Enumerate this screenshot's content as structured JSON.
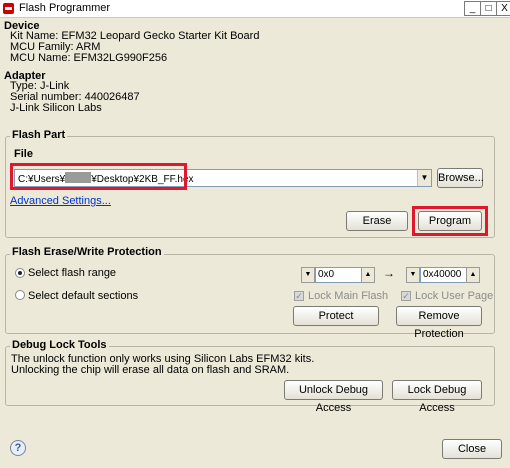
{
  "window": {
    "title": "Flash Programmer",
    "min_symbol": "_",
    "max_symbol": "□",
    "close_symbol": "X"
  },
  "device": {
    "title": "Device",
    "kit_name": "Kit Name: EFM32 Leopard Gecko Starter Kit Board",
    "mcu_family": "MCU Family: ARM",
    "mcu_name": "MCU Name: EFM32LG990F256"
  },
  "adapter": {
    "title": "Adapter",
    "type": "Type: J-Link",
    "serial": "Serial number: 440026487",
    "name": "J-Link Silicon Labs"
  },
  "flash_part": {
    "legend": "Flash Part",
    "file_label": "File",
    "path_prefix": "C:¥Users¥",
    "path_suffix": "¥Desktop¥2KB_FF.hex",
    "browse_label": "Browse...",
    "advanced_link": "Advanced Settings...",
    "erase_label": "Erase",
    "program_label": "Program"
  },
  "protection": {
    "legend": "Flash Erase/Write Protection",
    "select_range_label": "Select flash range",
    "select_default_label": "Select default sections",
    "range_start": "0x0",
    "range_end": "0x40000",
    "arrow": "→",
    "lock_main_label": "Lock Main Flash",
    "lock_user_label": "Lock User Page",
    "protect_label": "Protect",
    "remove_label": "Remove Protection"
  },
  "debug_lock": {
    "legend": "Debug Lock Tools",
    "line1": "The unlock function only works using Silicon Labs EFM32 kits.",
    "line2": "Unlocking the chip will erase all data on flash and SRAM.",
    "unlock_label": "Unlock Debug Access",
    "lock_label": "Lock Debug Access"
  },
  "footer": {
    "help_symbol": "?",
    "close_label": "Close"
  },
  "colors": {
    "highlight": "#e0182d",
    "background": "#ece9d8",
    "link": "#0033cc"
  }
}
